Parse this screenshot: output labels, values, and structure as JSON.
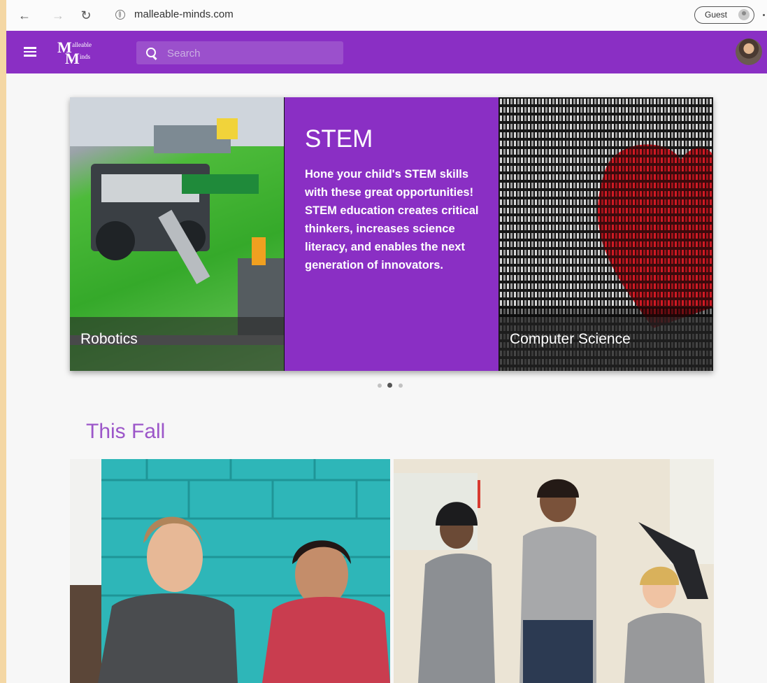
{
  "browser": {
    "url": "malleable-minds.com",
    "profile_label": "Guest"
  },
  "appbar": {
    "logo_letter_top": "M",
    "logo_letter_bottom": "M",
    "logo_word_top": "alleable",
    "logo_word_bottom": "inds",
    "search_placeholder": "Search"
  },
  "carousel": {
    "left_caption": "Robotics",
    "feature_title": "STEM",
    "feature_body": "Hone your child's STEM skills with these great opportunities! STEM education creates critical thinkers, increases science literacy, and enables the next generation of innovators.",
    "right_caption": "Computer Science",
    "dot_count": 3,
    "active_dot": 2
  },
  "section": {
    "title": "This Fall"
  },
  "colors": {
    "brand": "#8a2fc4",
    "section_title": "#9c56c9"
  }
}
